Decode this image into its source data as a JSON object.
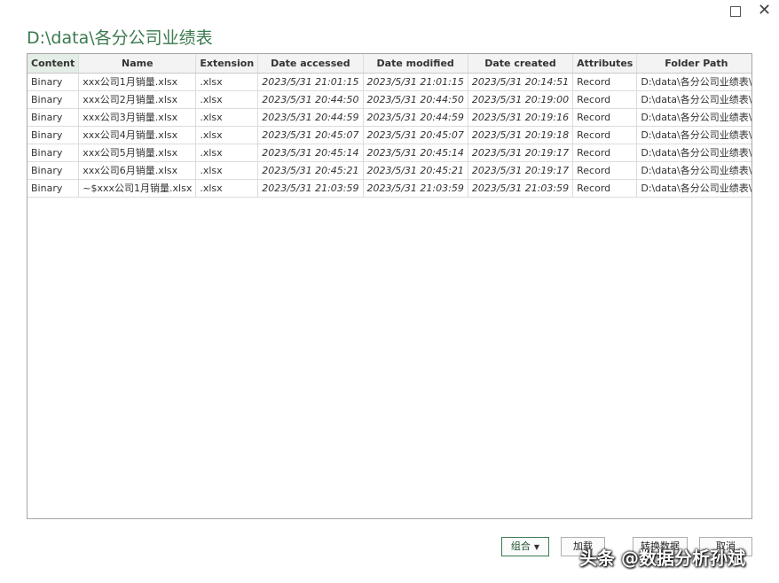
{
  "window": {
    "maximize_icon": "maximize-icon",
    "close_glyph": "✕"
  },
  "title": "D:\\data\\各分公司业绩表",
  "table": {
    "columns": [
      "Content",
      "Name",
      "Extension",
      "Date accessed",
      "Date modified",
      "Date created",
      "Attributes",
      "Folder Path"
    ],
    "rows": [
      [
        "Binary",
        "xxx公司1月销量.xlsx",
        ".xlsx",
        "2023/5/31 21:01:15",
        "2023/5/31 21:01:15",
        "2023/5/31 20:14:51",
        "Record",
        "D:\\data\\各分公司业绩表\\"
      ],
      [
        "Binary",
        "xxx公司2月销量.xlsx",
        ".xlsx",
        "2023/5/31 20:44:50",
        "2023/5/31 20:44:50",
        "2023/5/31 20:19:00",
        "Record",
        "D:\\data\\各分公司业绩表\\"
      ],
      [
        "Binary",
        "xxx公司3月销量.xlsx",
        ".xlsx",
        "2023/5/31 20:44:59",
        "2023/5/31 20:44:59",
        "2023/5/31 20:19:16",
        "Record",
        "D:\\data\\各分公司业绩表\\"
      ],
      [
        "Binary",
        "xxx公司4月销量.xlsx",
        ".xlsx",
        "2023/5/31 20:45:07",
        "2023/5/31 20:45:07",
        "2023/5/31 20:19:18",
        "Record",
        "D:\\data\\各分公司业绩表\\"
      ],
      [
        "Binary",
        "xxx公司5月销量.xlsx",
        ".xlsx",
        "2023/5/31 20:45:14",
        "2023/5/31 20:45:14",
        "2023/5/31 20:19:17",
        "Record",
        "D:\\data\\各分公司业绩表\\"
      ],
      [
        "Binary",
        "xxx公司6月销量.xlsx",
        ".xlsx",
        "2023/5/31 20:45:21",
        "2023/5/31 20:45:21",
        "2023/5/31 20:19:17",
        "Record",
        "D:\\data\\各分公司业绩表\\"
      ],
      [
        "Binary",
        "~$xxx公司1月销量.xlsx",
        ".xlsx",
        "2023/5/31 21:03:59",
        "2023/5/31 21:03:59",
        "2023/5/31 21:03:59",
        "Record",
        "D:\\data\\各分公司业绩表\\"
      ]
    ]
  },
  "buttons": {
    "combine": "组合",
    "load": "加载",
    "transform": "转换数据",
    "cancel": "取消"
  },
  "watermark": "头条 @数据分析孙斌",
  "colors": {
    "title": "#3b7a4f",
    "accent": "#3b7a4f"
  }
}
